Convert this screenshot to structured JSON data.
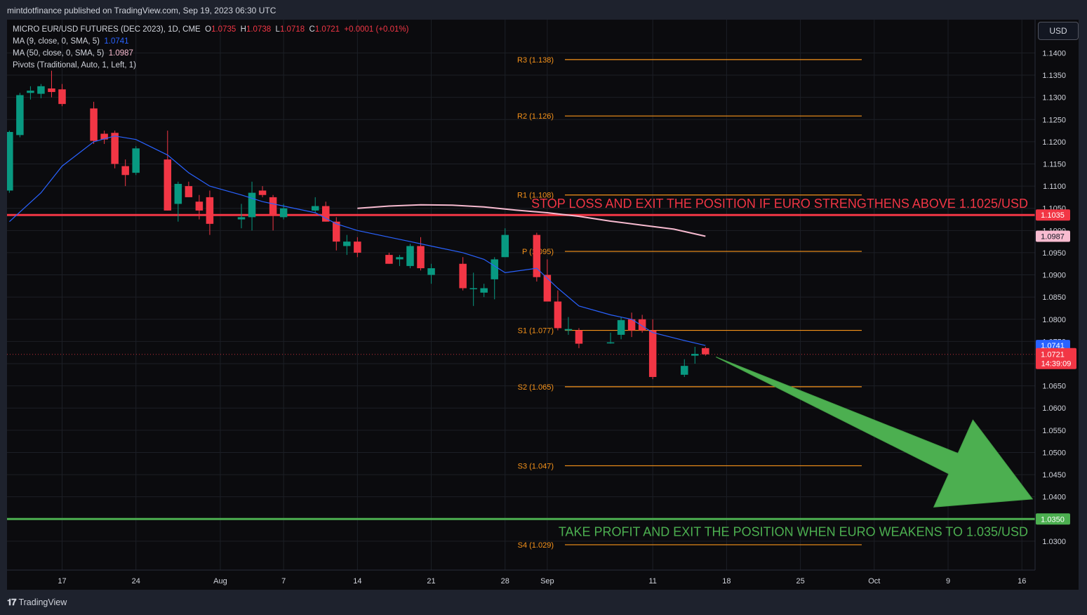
{
  "header": {
    "publish_info": "mintdotfinance published on TradingView.com, Sep 19, 2023 06:30 UTC"
  },
  "legend": {
    "symbol": "MICRO EUR/USD FUTURES (DEC 2023), 1D, CME",
    "o_label": "O",
    "o_value": "1.0735",
    "h_label": "H",
    "h_value": "1.0738",
    "l_label": "L",
    "l_value": "1.0718",
    "c_label": "C",
    "c_value": "1.0721",
    "change": "+0.0001 (+0.01%)",
    "ma1_label": "MA (9, close, 0, SMA, 5)",
    "ma1_value": "1.0741",
    "ma2_label": "MA (50, close, 0, SMA, 5)",
    "ma2_value": "1.0987",
    "pivots_label": "Pivots (Traditional, Auto, 1, Left, 1)"
  },
  "currency_button": "USD",
  "footer": {
    "brand": "TradingView"
  },
  "chart_data": {
    "type": "candlestick",
    "colors": {
      "up": "#089981",
      "down": "#f23645",
      "ma9": "#2962ff",
      "ma50": "#f8bbd0",
      "pivot": "#f7931a",
      "stop": "#f23645",
      "target": "#4caf50",
      "background": "#0b0b0e"
    },
    "ylim": [
      1.0235,
      1.1475
    ],
    "y_ticks": [
      "1.1400",
      "1.1350",
      "1.1300",
      "1.1250",
      "1.1200",
      "1.1150",
      "1.1100",
      "1.1050",
      "1.1000",
      "1.0950",
      "1.0900",
      "1.0850",
      "1.0800",
      "1.0750",
      "1.0700",
      "1.0650",
      "1.0600",
      "1.0550",
      "1.0500",
      "1.0450",
      "1.0400",
      "1.0350",
      "1.0300"
    ],
    "x_ticks": [
      {
        "label": "17",
        "day": 0
      },
      {
        "label": "24",
        "day": 7
      },
      {
        "label": "Aug",
        "day": 15
      },
      {
        "label": "7",
        "day": 21
      },
      {
        "label": "14",
        "day": 28
      },
      {
        "label": "21",
        "day": 35
      },
      {
        "label": "28",
        "day": 42
      },
      {
        "label": "Sep",
        "day": 46
      },
      {
        "label": "11",
        "day": 56
      },
      {
        "label": "18",
        "day": 63
      },
      {
        "label": "25",
        "day": 70
      },
      {
        "label": "Oct",
        "day": 77
      },
      {
        "label": "9",
        "day": 84
      },
      {
        "label": "16",
        "day": 91
      }
    ],
    "candles": [
      {
        "day": -5,
        "o": 1.109,
        "h": 1.1225,
        "l": 1.1085,
        "c": 1.1222
      },
      {
        "day": -4,
        "o": 1.1215,
        "h": 1.131,
        "l": 1.121,
        "c": 1.1305
      },
      {
        "day": -3,
        "o": 1.131,
        "h": 1.1325,
        "l": 1.1295,
        "c": 1.1315
      },
      {
        "day": -2,
        "o": 1.1308,
        "h": 1.133,
        "l": 1.1298,
        "c": 1.1325
      },
      {
        "day": -1,
        "o": 1.132,
        "h": 1.136,
        "l": 1.13,
        "c": 1.1312
      },
      {
        "day": 0,
        "o": 1.1318,
        "h": 1.133,
        "l": 1.128,
        "c": 1.1285
      },
      {
        "day": 3,
        "o": 1.1275,
        "h": 1.129,
        "l": 1.1195,
        "c": 1.1202
      },
      {
        "day": 4,
        "o": 1.1218,
        "h": 1.1225,
        "l": 1.1195,
        "c": 1.1205
      },
      {
        "day": 5,
        "o": 1.122,
        "h": 1.1225,
        "l": 1.114,
        "c": 1.115
      },
      {
        "day": 6,
        "o": 1.1145,
        "h": 1.116,
        "l": 1.11,
        "c": 1.1125
      },
      {
        "day": 7,
        "o": 1.113,
        "h": 1.119,
        "l": 1.1125,
        "c": 1.1185
      },
      {
        "day": 10,
        "o": 1.116,
        "h": 1.1225,
        "l": 1.1045,
        "c": 1.1045
      },
      {
        "day": 11,
        "o": 1.106,
        "h": 1.111,
        "l": 1.102,
        "c": 1.1105
      },
      {
        "day": 12,
        "o": 1.11,
        "h": 1.111,
        "l": 1.1075,
        "c": 1.1075
      },
      {
        "day": 13,
        "o": 1.1065,
        "h": 1.108,
        "l": 1.1025,
        "c": 1.1045
      },
      {
        "day": 14,
        "o": 1.1075,
        "h": 1.109,
        "l": 1.099,
        "c": 1.1015
      },
      {
        "day": 17,
        "o": 1.1025,
        "h": 1.106,
        "l": 1.1005,
        "c": 1.103
      },
      {
        "day": 18,
        "o": 1.103,
        "h": 1.111,
        "l": 1.1,
        "c": 1.1085
      },
      {
        "day": 19,
        "o": 1.109,
        "h": 1.11,
        "l": 1.1075,
        "c": 1.108
      },
      {
        "day": 20,
        "o": 1.1075,
        "h": 1.108,
        "l": 1.1,
        "c": 1.1035
      },
      {
        "day": 21,
        "o": 1.103,
        "h": 1.106,
        "l": 1.1025,
        "c": 1.105
      },
      {
        "day": 24,
        "o": 1.1045,
        "h": 1.1075,
        "l": 1.104,
        "c": 1.1055
      },
      {
        "day": 25,
        "o": 1.1055,
        "h": 1.1065,
        "l": 1.102,
        "c": 1.102
      },
      {
        "day": 26,
        "o": 1.102,
        "h": 1.103,
        "l": 1.0955,
        "c": 1.0975
      },
      {
        "day": 27,
        "o": 1.0965,
        "h": 1.099,
        "l": 1.0945,
        "c": 1.0975
      },
      {
        "day": 28,
        "o": 1.0975,
        "h": 1.0985,
        "l": 1.094,
        "c": 1.095
      },
      {
        "day": 31,
        "o": 1.0945,
        "h": 1.095,
        "l": 1.0925,
        "c": 1.0925
      },
      {
        "day": 32,
        "o": 1.0935,
        "h": 1.0945,
        "l": 1.092,
        "c": 1.094
      },
      {
        "day": 33,
        "o": 1.092,
        "h": 1.097,
        "l": 1.0915,
        "c": 1.0965
      },
      {
        "day": 34,
        "o": 1.0965,
        "h": 1.0985,
        "l": 1.091,
        "c": 1.0915
      },
      {
        "day": 35,
        "o": 1.09,
        "h": 1.0925,
        "l": 1.088,
        "c": 1.0915
      },
      {
        "day": 38,
        "o": 1.0925,
        "h": 1.094,
        "l": 1.0865,
        "c": 1.087
      },
      {
        "day": 39,
        "o": 1.087,
        "h": 1.0905,
        "l": 1.083,
        "c": 1.087
      },
      {
        "day": 40,
        "o": 1.086,
        "h": 1.088,
        "l": 1.085,
        "c": 1.087
      },
      {
        "day": 41,
        "o": 1.089,
        "h": 1.094,
        "l": 1.0845,
        "c": 1.0935
      },
      {
        "day": 42,
        "o": 1.094,
        "h": 1.1005,
        "l": 1.094,
        "c": 1.099
      },
      {
        "day": 45,
        "o": 1.099,
        "h": 1.0995,
        "l": 1.0885,
        "c": 1.0895
      },
      {
        "day": 46,
        "o": 1.09,
        "h": 1.0935,
        "l": 1.0865,
        "c": 1.084
      },
      {
        "day": 47,
        "o": 1.084,
        "h": 1.0865,
        "l": 1.0775,
        "c": 1.078
      },
      {
        "day": 48,
        "o": 1.0775,
        "h": 1.0805,
        "l": 1.0765,
        "c": 1.0778
      },
      {
        "day": 49,
        "o": 1.0775,
        "h": 1.078,
        "l": 1.0735,
        "c": 1.0745
      },
      {
        "day": 52,
        "o": 1.0748,
        "h": 1.077,
        "l": 1.0745,
        "c": 1.0748
      },
      {
        "day": 53,
        "o": 1.0765,
        "h": 1.0805,
        "l": 1.0755,
        "c": 1.0798
      },
      {
        "day": 54,
        "o": 1.08,
        "h": 1.0815,
        "l": 1.076,
        "c": 1.0775
      },
      {
        "day": 55,
        "o": 1.08,
        "h": 1.081,
        "l": 1.077,
        "c": 1.0775
      },
      {
        "day": 56,
        "o": 1.0775,
        "h": 1.08,
        "l": 1.0665,
        "c": 1.067
      },
      {
        "day": 59,
        "o": 1.0675,
        "h": 1.071,
        "l": 1.067,
        "c": 1.0695
      },
      {
        "day": 60,
        "o": 1.0718,
        "h": 1.0738,
        "l": 1.07,
        "c": 1.0722
      },
      {
        "day": 61,
        "o": 1.0735,
        "h": 1.0738,
        "l": 1.0718,
        "c": 1.0721
      }
    ],
    "series": [
      {
        "name": "MA (9, close, 0, SMA, 5)",
        "values": [
          [
            -5,
            1.102
          ],
          [
            -2,
            1.1085
          ],
          [
            0,
            1.1145
          ],
          [
            3,
            1.12
          ],
          [
            5,
            1.1213
          ],
          [
            7,
            1.1205
          ],
          [
            10,
            1.117
          ],
          [
            12,
            1.113
          ],
          [
            14,
            1.11
          ],
          [
            17,
            1.108
          ],
          [
            19,
            1.1065
          ],
          [
            21,
            1.1055
          ],
          [
            24,
            1.104
          ],
          [
            26,
            1.1015
          ],
          [
            28,
            1.1
          ],
          [
            31,
            1.0985
          ],
          [
            33,
            1.0975
          ],
          [
            35,
            1.0965
          ],
          [
            38,
            1.095
          ],
          [
            40,
            1.0935
          ],
          [
            42,
            1.0905
          ],
          [
            45,
            1.0915
          ],
          [
            47,
            1.087
          ],
          [
            49,
            1.083
          ],
          [
            52,
            1.081
          ],
          [
            54,
            1.08
          ],
          [
            56,
            1.077
          ],
          [
            59,
            1.0752
          ],
          [
            61,
            1.0741
          ]
        ]
      },
      {
        "name": "MA (50, close, 0, SMA, 5)",
        "values": [
          [
            28,
            1.105
          ],
          [
            31,
            1.1055
          ],
          [
            34,
            1.1058
          ],
          [
            37,
            1.1057
          ],
          [
            40,
            1.1053
          ],
          [
            43,
            1.1046
          ],
          [
            46,
            1.104
          ],
          [
            49,
            1.1032
          ],
          [
            52,
            1.1021
          ],
          [
            55,
            1.1012
          ],
          [
            58,
            1.1003
          ],
          [
            61,
            1.0987
          ]
        ]
      }
    ],
    "pivots": [
      {
        "label": "R3 (1.138)",
        "value": 1.1385
      },
      {
        "label": "R2 (1.126)",
        "value": 1.1258
      },
      {
        "label": "R1 (1.108)",
        "value": 1.108
      },
      {
        "label": "P (1.095)",
        "value": 1.0953
      },
      {
        "label": "S1 (1.077)",
        "value": 1.0775
      },
      {
        "label": "S2 (1.065)",
        "value": 1.0648
      },
      {
        "label": "S3 (1.047)",
        "value": 1.047
      },
      {
        "label": "S4 (1.029)",
        "value": 1.0292
      }
    ],
    "horizontal_lines": [
      {
        "name": "stop-loss",
        "value": 1.1035,
        "label": "1.1035",
        "text": "STOP LOSS AND EXIT THE POSITION IF EURO STRENGTHENS ABOVE 1.1025/USD"
      },
      {
        "name": "take-profit",
        "value": 1.035,
        "label": "1.0350",
        "text": "TAKE PROFIT AND EXIT THE POSITION WHEN EURO WEAKENS TO 1.035/USD"
      }
    ],
    "price_labels": {
      "ma9": "1.0741",
      "ma50": "1.0987",
      "last": "1.0721",
      "countdown": "14:39:09"
    },
    "arrow": {
      "from": {
        "day": 62,
        "price": 1.0715
      },
      "to": {
        "day": 92,
        "price": 1.0395
      }
    }
  }
}
